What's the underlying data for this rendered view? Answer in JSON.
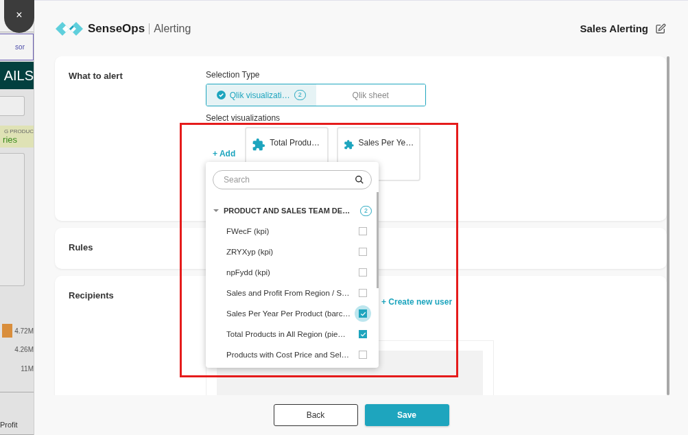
{
  "background_app": {
    "tab": "sor",
    "banner": "AILS",
    "category_header": "G PRODUC",
    "category": "ries",
    "values": [
      "4.72M",
      "4.26M",
      "11M"
    ],
    "footer_label": "Profit"
  },
  "close_button": "×",
  "header": {
    "brand": "SenseOps",
    "product": "Alerting",
    "title": "Sales Alerting"
  },
  "what_to_alert": {
    "title": "What to alert",
    "selection_type_label": "Selection Type",
    "selection_types": [
      {
        "label": "Qlik visualizati…",
        "count": "2",
        "selected": true
      },
      {
        "label": "Qlik sheet",
        "selected": false
      }
    ],
    "select_label": "Select visualizations",
    "add_link": "+ Add",
    "visualizations": [
      {
        "title": "Total Produ…"
      },
      {
        "title": "Sales Per Ye…"
      }
    ]
  },
  "dropdown": {
    "placeholder": "Search",
    "group": {
      "title": "PRODUCT AND SALES TEAM DE…",
      "count": "2",
      "expanded": true,
      "items": [
        {
          "label": "FWecF (kpi)",
          "checked": false,
          "focused": false
        },
        {
          "label": "ZRYXyp (kpi)",
          "checked": false,
          "focused": false
        },
        {
          "label": "npFydd (kpi)",
          "checked": false,
          "focused": false
        },
        {
          "label": "Sales and Profit From Region / S…",
          "checked": false,
          "focused": false
        },
        {
          "label": "Sales Per Year Per Product (barc…",
          "checked": true,
          "focused": true
        },
        {
          "label": "Total Products in All Region (pie…",
          "checked": true,
          "focused": false
        },
        {
          "label": "Products with Cost Price and Sel…",
          "checked": false,
          "focused": false
        }
      ]
    }
  },
  "rules": {
    "title": "Rules"
  },
  "recipients": {
    "title": "Recipients",
    "create_link": "+ Create new user"
  },
  "buttons": [
    {
      "label": "Back",
      "kind": "secondary"
    },
    {
      "label": "Save",
      "kind": "primary"
    }
  ]
}
